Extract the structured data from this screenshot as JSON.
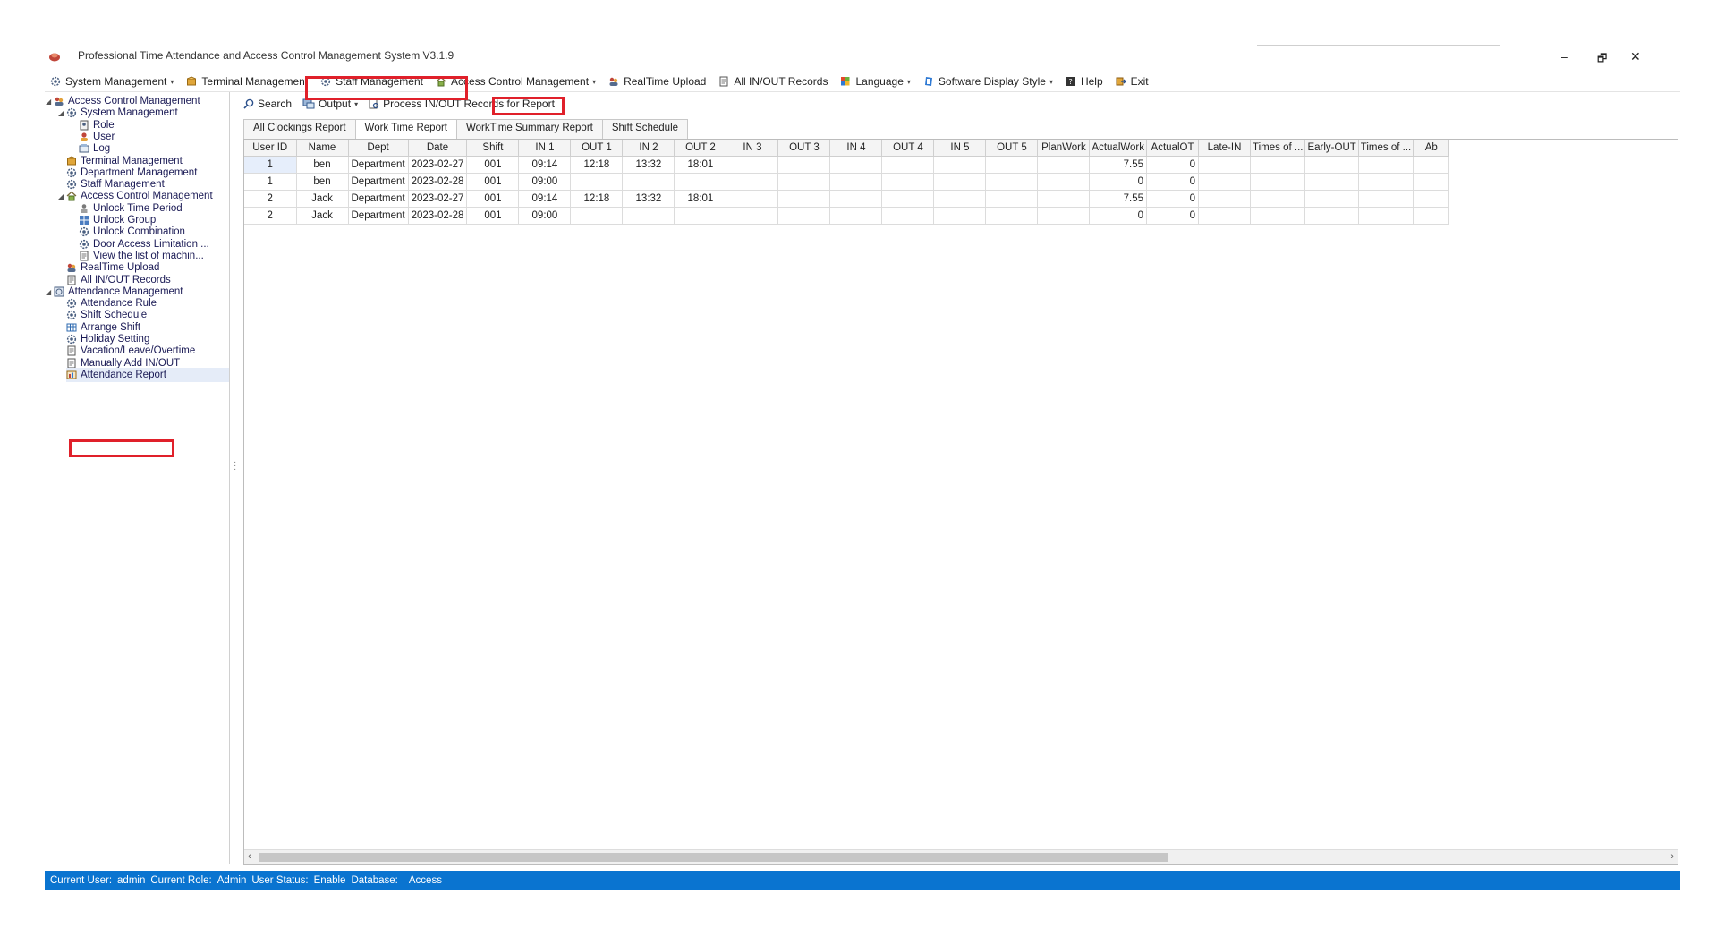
{
  "window": {
    "title": "Professional Time Attendance and Access Control Management System V3.1.9",
    "minimize": "–",
    "restore": "🗗",
    "close": "✕"
  },
  "menu": [
    {
      "label": "System Management",
      "icon": "gear-icon",
      "caret": true
    },
    {
      "label": "Terminal Management",
      "icon": "box-icon",
      "caret": false
    },
    {
      "label": "Staff Management",
      "icon": "gear-icon",
      "caret": false
    },
    {
      "label": "Access Control Management",
      "icon": "home-icon",
      "caret": true
    },
    {
      "label": "RealTime Upload",
      "icon": "users-icon",
      "caret": false
    },
    {
      "label": "All IN/OUT Records",
      "icon": "document-icon",
      "caret": false
    },
    {
      "label": "Language",
      "icon": "flag-icon",
      "caret": true
    },
    {
      "label": "Software Display Style",
      "icon": "style-icon",
      "caret": true
    },
    {
      "label": "Help",
      "icon": "help-icon",
      "caret": false
    },
    {
      "label": "Exit",
      "icon": "exit-icon",
      "caret": false
    }
  ],
  "tree": [
    {
      "label": "Access Control Management",
      "level": 0,
      "expand": "◢",
      "icon": "users-icon"
    },
    {
      "label": "System Management",
      "level": 1,
      "expand": "◢",
      "icon": "gear-icon"
    },
    {
      "label": "Role",
      "level": 2,
      "expand": "",
      "icon": "role-icon"
    },
    {
      "label": "User",
      "level": 2,
      "expand": "",
      "icon": "user-icon"
    },
    {
      "label": "Log",
      "level": 2,
      "expand": "",
      "icon": "log-icon"
    },
    {
      "label": "Terminal Management",
      "level": 1,
      "expand": "",
      "icon": "box-icon"
    },
    {
      "label": "Department Management",
      "level": 1,
      "expand": "",
      "icon": "gear-icon"
    },
    {
      "label": "Staff Management",
      "level": 1,
      "expand": "",
      "icon": "gear-icon"
    },
    {
      "label": "Access Control Management",
      "level": 1,
      "expand": "◢",
      "icon": "home-icon"
    },
    {
      "label": "Unlock Time Period",
      "level": 2,
      "expand": "",
      "icon": "person-icon"
    },
    {
      "label": "Unlock Group",
      "level": 2,
      "expand": "",
      "icon": "group-icon"
    },
    {
      "label": "Unlock Combination",
      "level": 2,
      "expand": "",
      "icon": "gear-icon"
    },
    {
      "label": "Door Access Limitation ...",
      "level": 2,
      "expand": "",
      "icon": "gear-icon"
    },
    {
      "label": "View the list of machin...",
      "level": 2,
      "expand": "",
      "icon": "document-icon"
    },
    {
      "label": "RealTime Upload",
      "level": 1,
      "expand": "",
      "icon": "users-icon"
    },
    {
      "label": "All IN/OUT Records",
      "level": 1,
      "expand": "",
      "icon": "document-icon"
    },
    {
      "label": "Attendance Management",
      "level": 0,
      "expand": "◢",
      "icon": "clock-icon"
    },
    {
      "label": "Attendance Rule",
      "level": 1,
      "expand": "",
      "icon": "gear-icon"
    },
    {
      "label": "Shift Schedule",
      "level": 1,
      "expand": "",
      "icon": "gear-icon"
    },
    {
      "label": "Arrange Shift",
      "level": 1,
      "expand": "",
      "icon": "grid-icon"
    },
    {
      "label": "Holiday Setting",
      "level": 1,
      "expand": "",
      "icon": "gear-icon"
    },
    {
      "label": "Vacation/Leave/Overtime",
      "level": 1,
      "expand": "",
      "icon": "document-icon"
    },
    {
      "label": "Manually Add IN/OUT",
      "level": 1,
      "expand": "",
      "icon": "document-icon"
    },
    {
      "label": "Attendance Report",
      "level": 1,
      "expand": "",
      "icon": "report-icon",
      "selected": true
    }
  ],
  "toolbar": {
    "search": "Search",
    "output": "Output",
    "process": "Process IN/OUT Records for Report"
  },
  "tabs": [
    "All Clockings Report",
    "Work Time Report",
    "WorkTime Summary Report",
    "Shift Schedule"
  ],
  "active_tab": 1,
  "grid": {
    "columns": [
      "User ID",
      "Name",
      "Dept",
      "Date",
      "Shift",
      "IN 1",
      "OUT 1",
      "IN 2",
      "OUT 2",
      "IN 3",
      "OUT 3",
      "IN 4",
      "OUT 4",
      "IN 5",
      "OUT 5",
      "PlanWork",
      "ActualWork",
      "ActualOT",
      "Late-IN",
      "Times of ...",
      "Early-OUT",
      "Times of ...",
      "Ab"
    ],
    "rows": [
      [
        "1",
        "ben",
        "Department",
        "2023-02-27",
        "001",
        "09:14",
        "12:18",
        "13:32",
        "18:01",
        "",
        "",
        "",
        "",
        "",
        "",
        "",
        "7.55",
        "0",
        "",
        "",
        "",
        "",
        ""
      ],
      [
        "1",
        "ben",
        "Department",
        "2023-02-28",
        "001",
        "09:00",
        "",
        "",
        "",
        "",
        "",
        "",
        "",
        "",
        "",
        "",
        "0",
        "0",
        "",
        "",
        "",
        "",
        ""
      ],
      [
        "2",
        "Jack",
        "Department",
        "2023-02-27",
        "001",
        "09:14",
        "12:18",
        "13:32",
        "18:01",
        "",
        "",
        "",
        "",
        "",
        "",
        "",
        "7.55",
        "0",
        "",
        "",
        "",
        "",
        ""
      ],
      [
        "2",
        "Jack",
        "Department",
        "2023-02-28",
        "001",
        "09:00",
        "",
        "",
        "",
        "",
        "",
        "",
        "",
        "",
        "",
        "",
        "0",
        "0",
        "",
        "",
        "",
        "",
        ""
      ]
    ]
  },
  "status": {
    "user_label": "Current User:",
    "user": "admin",
    "role_label": "Current Role:",
    "role": "Admin",
    "ustatus_label": "User Status:",
    "ustatus": "Enable",
    "db_label": "Database:",
    "db": "Access"
  },
  "colors": {
    "status_bar": "#0a74d0",
    "highlight": "#e0202a"
  }
}
